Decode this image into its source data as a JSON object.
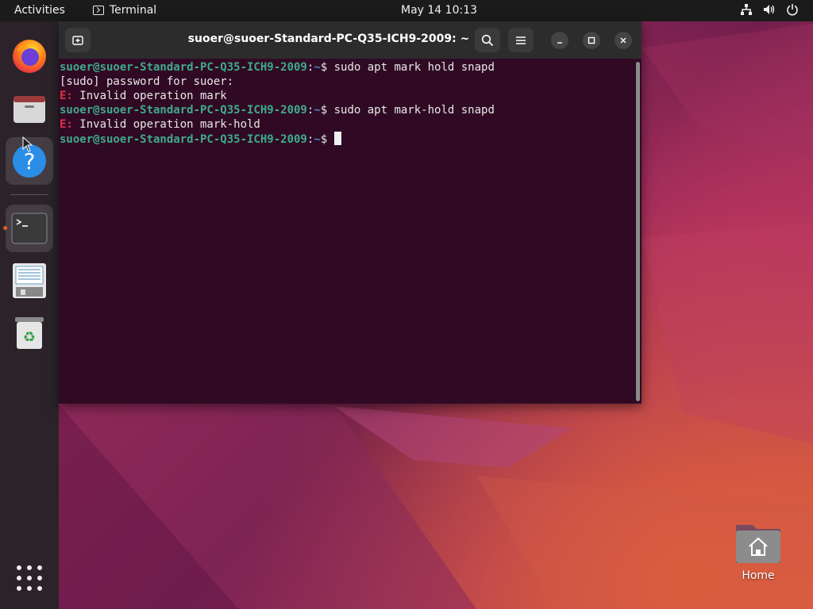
{
  "topbar": {
    "activities": "Activities",
    "app_name": "Terminal",
    "clock": "May 14  10:13"
  },
  "dock": {
    "items": [
      "firefox-icon",
      "files-icon",
      "help-icon",
      "terminal-icon",
      "text-editor-icon",
      "trash-icon",
      "show-apps-icon"
    ],
    "active_item": "terminal"
  },
  "terminal": {
    "title": "suoer@suoer-Standard-PC-Q35-ICH9-2009: ~",
    "lines": [
      {
        "user": "suoer@suoer-Standard-PC-Q35-ICH9-2009",
        "path": "~",
        "command": "sudo apt mark hold snapd"
      },
      {
        "text": "[sudo] password for suoer:"
      },
      {
        "err_prefix": "E:",
        "text": " Invalid operation mark"
      },
      {
        "user": "suoer@suoer-Standard-PC-Q35-ICH9-2009",
        "path": "~",
        "command": "sudo apt mark-hold snapd"
      },
      {
        "err_prefix": "E:",
        "text": " Invalid operation mark-hold"
      },
      {
        "user": "suoer@suoer-Standard-PC-Q35-ICH9-2009",
        "path": "~",
        "command": ""
      }
    ]
  },
  "desktop": {
    "home_label": "Home"
  },
  "colors": {
    "terminal_bg": "#300a24",
    "prompt_user": "#3faa8c",
    "prompt_path": "#4f84c4",
    "error": "#e0304a",
    "accent": "#e95420"
  }
}
